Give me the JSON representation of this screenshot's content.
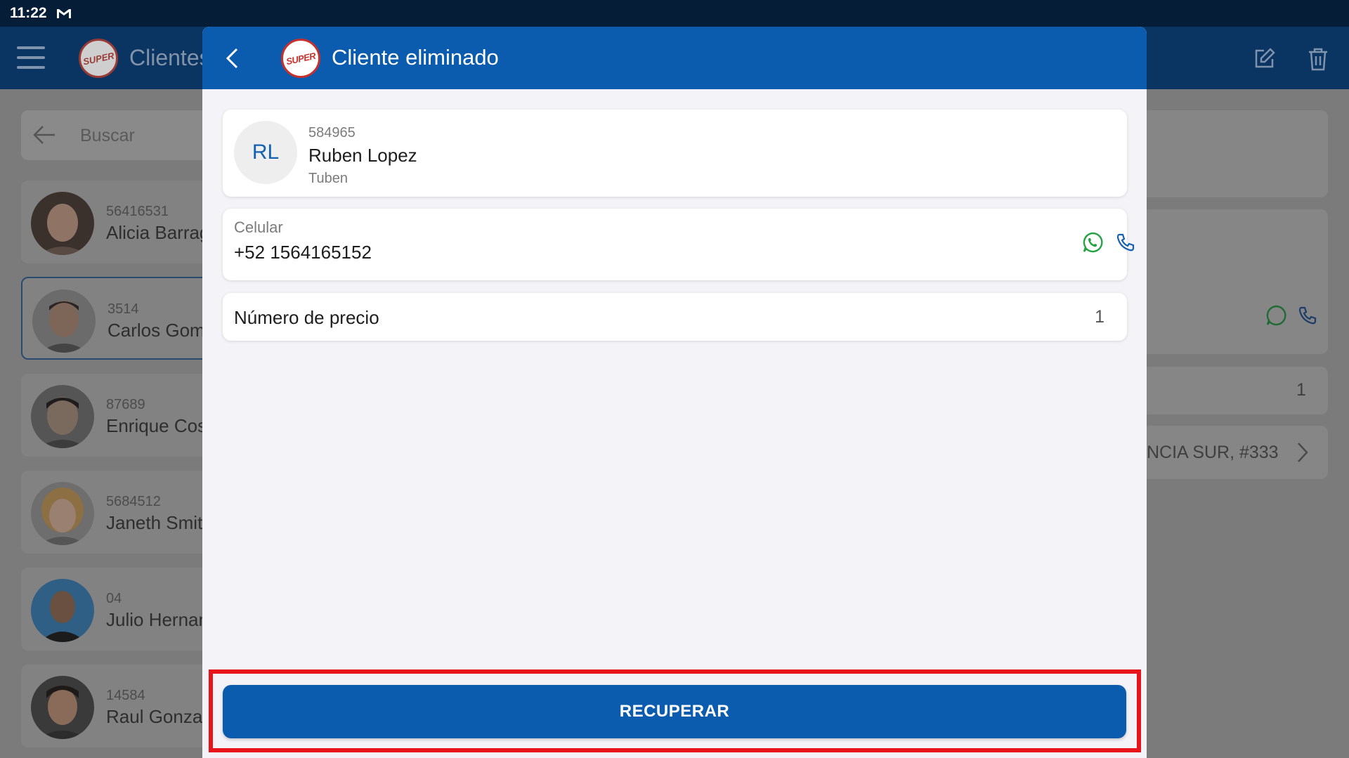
{
  "status_bar": {
    "time": "11:22",
    "mail_icon": "gmail-icon"
  },
  "background": {
    "app_title": "Clientes",
    "search_placeholder": "Buscar",
    "clients": [
      {
        "code": "56416531",
        "name": "Alicia Barrag"
      },
      {
        "code": "3514",
        "name": "Carlos Gom"
      },
      {
        "code": "87689",
        "name": "Enrique Cos"
      },
      {
        "code": "5684512",
        "name": "Janeth Smit"
      },
      {
        "code": "04",
        "name": "Julio Hernan"
      },
      {
        "code": "14584",
        "name": "Raul Gonzal"
      }
    ],
    "detail_price_value": "1",
    "detail_address": "NCIA SUR, #333"
  },
  "modal": {
    "title": "Cliente eliminado",
    "logo_text": "SUPER",
    "client": {
      "initials": "RL",
      "code": "584965",
      "name": "Ruben Lopez",
      "subtitle": "Tuben"
    },
    "phone": {
      "label": "Celular",
      "value": "+52 1564165152"
    },
    "price": {
      "label": "Número de precio",
      "value": "1"
    },
    "recover_button": "RECUPERAR"
  },
  "colors": {
    "primary": "#0b5cae",
    "status_bar": "#051d37",
    "highlight": "#e8141c",
    "whatsapp": "#25a244"
  }
}
